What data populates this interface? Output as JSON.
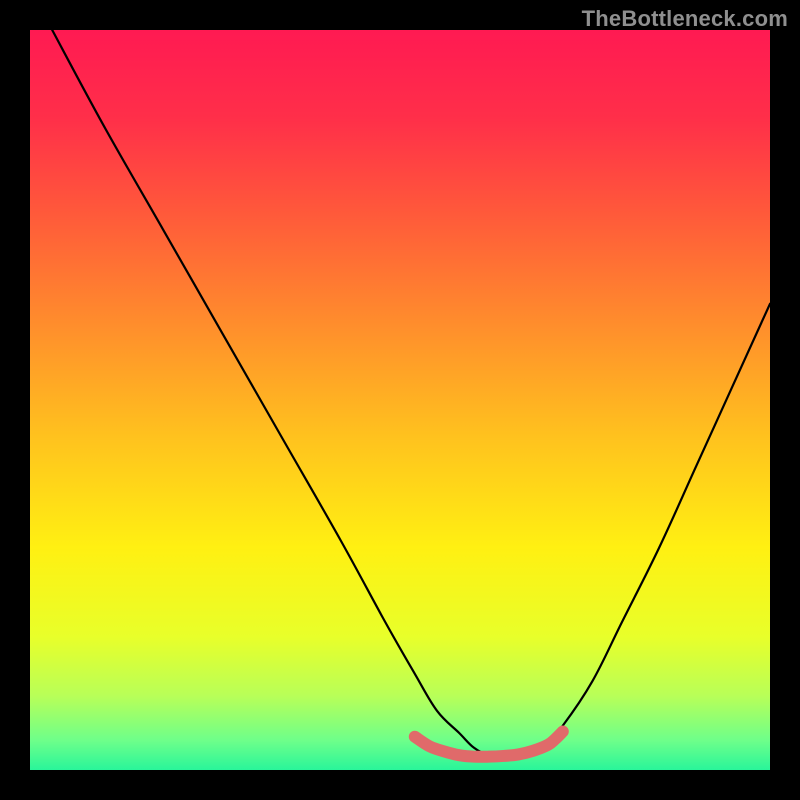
{
  "watermark": "TheBottleneck.com",
  "chart_data": {
    "type": "line",
    "title": "",
    "xlabel": "",
    "ylabel": "",
    "xlim": [
      0,
      100
    ],
    "ylim": [
      0,
      100
    ],
    "background_gradient_stops": [
      {
        "offset": 0.0,
        "color": "#ff1a52"
      },
      {
        "offset": 0.12,
        "color": "#ff2f49"
      },
      {
        "offset": 0.25,
        "color": "#ff5a3a"
      },
      {
        "offset": 0.4,
        "color": "#ff8e2c"
      },
      {
        "offset": 0.55,
        "color": "#ffc21e"
      },
      {
        "offset": 0.7,
        "color": "#fff012"
      },
      {
        "offset": 0.82,
        "color": "#e8ff2a"
      },
      {
        "offset": 0.9,
        "color": "#b8ff58"
      },
      {
        "offset": 0.96,
        "color": "#6eff8a"
      },
      {
        "offset": 1.0,
        "color": "#29f59a"
      }
    ],
    "series": [
      {
        "name": "bottleneck-curve",
        "color": "#000000",
        "x": [
          3,
          10,
          18,
          26,
          34,
          42,
          48,
          52,
          55,
          58,
          60,
          62,
          64,
          66,
          68,
          70,
          72,
          76,
          80,
          85,
          90,
          95,
          100
        ],
        "y": [
          100,
          87,
          73,
          59,
          45,
          31,
          20,
          13,
          8,
          5,
          3,
          2,
          2,
          2,
          3,
          4,
          6,
          12,
          20,
          30,
          41,
          52,
          63
        ]
      },
      {
        "name": "optimal-region-overlay",
        "color": "#e06a6a",
        "x": [
          52,
          54,
          56,
          58,
          60,
          62,
          64,
          66,
          68,
          70,
          71,
          72
        ],
        "y": [
          4.5,
          3.2,
          2.5,
          2.0,
          1.8,
          1.8,
          1.9,
          2.1,
          2.6,
          3.4,
          4.2,
          5.2
        ]
      }
    ]
  }
}
